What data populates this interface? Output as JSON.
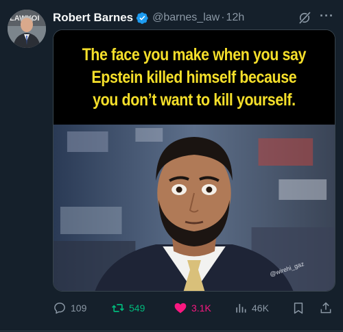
{
  "author": {
    "name": "Robert Barnes",
    "handle": "@barnes_law",
    "separator": "·",
    "time": "12h",
    "avatar_text": "LAWYOI"
  },
  "meme": {
    "lines": [
      "The face you make when you say",
      "Epstein killed himself because",
      "you don’t want to kill yourself."
    ],
    "watermark": "@wirehi_gaz"
  },
  "actions": {
    "replies": "109",
    "reposts": "549",
    "likes": "3.1K",
    "views": "46K"
  },
  "colors": {
    "background": "#15202b",
    "secondary_text": "#8b98a5",
    "verified": "#1d9bf0",
    "repost": "#00ba7c",
    "like": "#f91880",
    "meme_text": "#f5df2a"
  },
  "icons": {
    "verified": "verified-badge-icon",
    "grok": "grok-icon",
    "more": "more-icon",
    "reply": "reply-icon",
    "repost": "repost-icon",
    "like": "heart-icon",
    "views": "views-icon",
    "bookmark": "bookmark-icon",
    "share": "share-icon"
  }
}
